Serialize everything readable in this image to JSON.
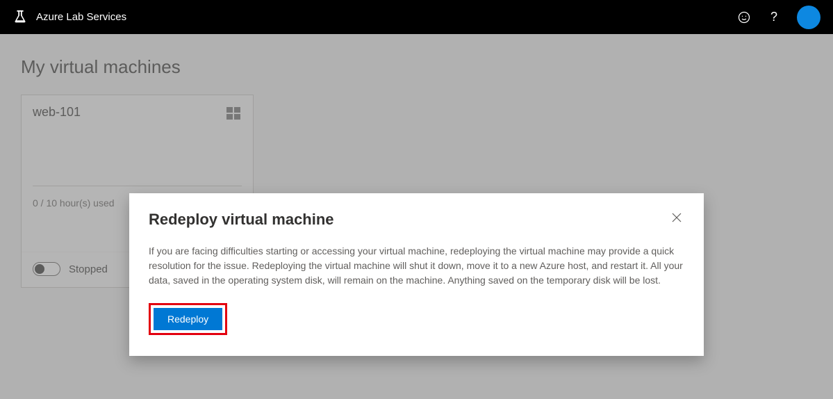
{
  "header": {
    "brand": "Azure Lab Services"
  },
  "page": {
    "title": "My virtual machines"
  },
  "vm_card": {
    "name": "web-101",
    "os_icon": "windows-icon",
    "usage": "0 / 10 hour(s) used",
    "status": "Stopped",
    "toggle_on": false
  },
  "dialog": {
    "title": "Redeploy virtual machine",
    "body": "If you are facing difficulties starting or accessing your virtual machine, redeploying the virtual machine may provide a quick resolution for the issue. Redeploying the virtual machine will shut it down, move it to a new Azure host, and restart it. All your data, saved in the operating system disk, will remain on the machine. Anything saved on the temporary disk will be lost.",
    "primary_button": "Redeploy"
  },
  "colors": {
    "accent": "#0078d4",
    "highlight_border": "#e3000f"
  }
}
